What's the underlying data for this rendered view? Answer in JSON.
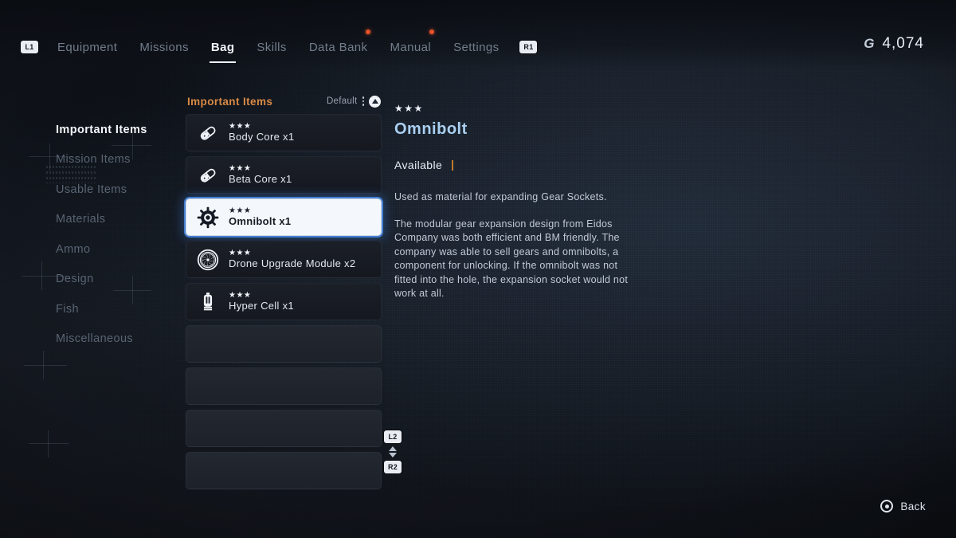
{
  "nav": {
    "left_key": "L1",
    "right_key": "R1",
    "tabs": [
      {
        "label": "Equipment",
        "active": false,
        "dot": false
      },
      {
        "label": "Missions",
        "active": false,
        "dot": false
      },
      {
        "label": "Bag",
        "active": true,
        "dot": false
      },
      {
        "label": "Skills",
        "active": false,
        "dot": false
      },
      {
        "label": "Data Bank",
        "active": false,
        "dot": true
      },
      {
        "label": "Manual",
        "active": false,
        "dot": true
      },
      {
        "label": "Settings",
        "active": false,
        "dot": false
      }
    ]
  },
  "currency": {
    "symbol": "G",
    "amount": "4,074"
  },
  "sidebar": {
    "items": [
      {
        "label": "Important Items",
        "active": true
      },
      {
        "label": "Mission Items",
        "active": false
      },
      {
        "label": "Usable Items",
        "active": false
      },
      {
        "label": "Materials",
        "active": false
      },
      {
        "label": "Ammo",
        "active": false
      },
      {
        "label": "Design",
        "active": false
      },
      {
        "label": "Fish",
        "active": false
      },
      {
        "label": "Miscellaneous",
        "active": false
      }
    ]
  },
  "item_list": {
    "title": "Important Items",
    "sort_label": "Default",
    "sort_icon": "triangle-up-icon",
    "rows": [
      {
        "stars": "★★★",
        "label": "Body Core x1",
        "icon": "capsule-icon",
        "selected": false,
        "empty": false
      },
      {
        "stars": "★★★",
        "label": "Beta Core x1",
        "icon": "capsule-icon",
        "selected": false,
        "empty": false
      },
      {
        "stars": "★★★",
        "label": "Omnibolt x1",
        "icon": "gear-bolt-icon",
        "selected": true,
        "empty": false
      },
      {
        "stars": "★★★",
        "label": "Drone Upgrade Module x2",
        "icon": "turbine-icon",
        "selected": false,
        "empty": false
      },
      {
        "stars": "★★★",
        "label": "Hyper Cell x1",
        "icon": "canister-icon",
        "selected": false,
        "empty": false
      },
      {
        "stars": "",
        "label": "",
        "icon": "",
        "selected": false,
        "empty": true
      },
      {
        "stars": "",
        "label": "",
        "icon": "",
        "selected": false,
        "empty": true
      },
      {
        "stars": "",
        "label": "",
        "icon": "",
        "selected": false,
        "empty": true
      },
      {
        "stars": "",
        "label": "",
        "icon": "",
        "selected": false,
        "empty": true
      }
    ]
  },
  "scroll_hint": {
    "up_key": "L2",
    "down_key": "R2"
  },
  "detail": {
    "stars": "★★★",
    "title": "Omnibolt",
    "status": "Available",
    "description_1": "Used as material for expanding Gear Sockets.",
    "description_2": "The modular gear expansion design from Eidos Company was both efficient and BM friendly. The company was able to sell gears and omnibolts, a component for unlocking. If the omnibolt was not fitted into the hole, the expansion socket would not work at all."
  },
  "footer": {
    "button_glyph": "circle-button-icon",
    "back_label": "Back"
  },
  "colors": {
    "accent_orange": "#d98a45",
    "title_blue": "#a9cff2",
    "selection_blue": "#4a8ce6",
    "notification_red": "#e8522a",
    "background": "#13171f"
  }
}
